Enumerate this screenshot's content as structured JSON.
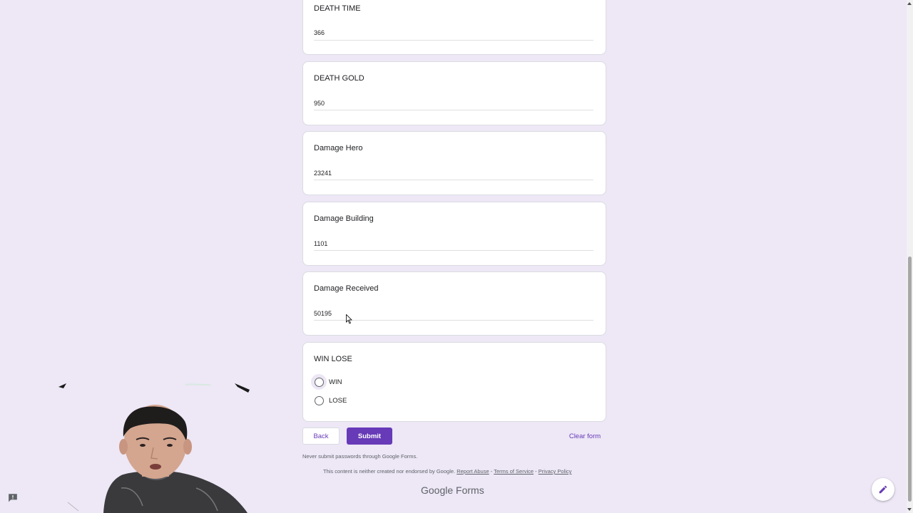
{
  "questions": [
    {
      "title": "DEATH TIME",
      "answer": "366"
    },
    {
      "title": "DEATH GOLD",
      "answer": "950"
    },
    {
      "title": "Damage Hero",
      "answer": "23241"
    },
    {
      "title": "Damage Building",
      "answer": "1101"
    },
    {
      "title": "Damage Received",
      "answer": "50195"
    }
  ],
  "win_lose": {
    "title": "WIN LOSE",
    "options": [
      "WIN",
      "LOSE"
    ]
  },
  "buttons": {
    "back": "Back",
    "submit": "Submit",
    "clear": "Clear form"
  },
  "footer": {
    "password_note": "Never submit passwords through Google Forms.",
    "disclaimer": "This content is neither created nor endorsed by Google.",
    "report_abuse": "Report Abuse",
    "terms": "Terms of Service",
    "privacy": "Privacy Policy",
    "separator": " - ",
    "brand_google": "Google",
    "brand_forms": "Forms"
  },
  "colors": {
    "accent": "#673ab7",
    "background": "#ede7f6"
  },
  "icons": {
    "edit": "pencil-icon",
    "report": "report-problem-icon"
  }
}
